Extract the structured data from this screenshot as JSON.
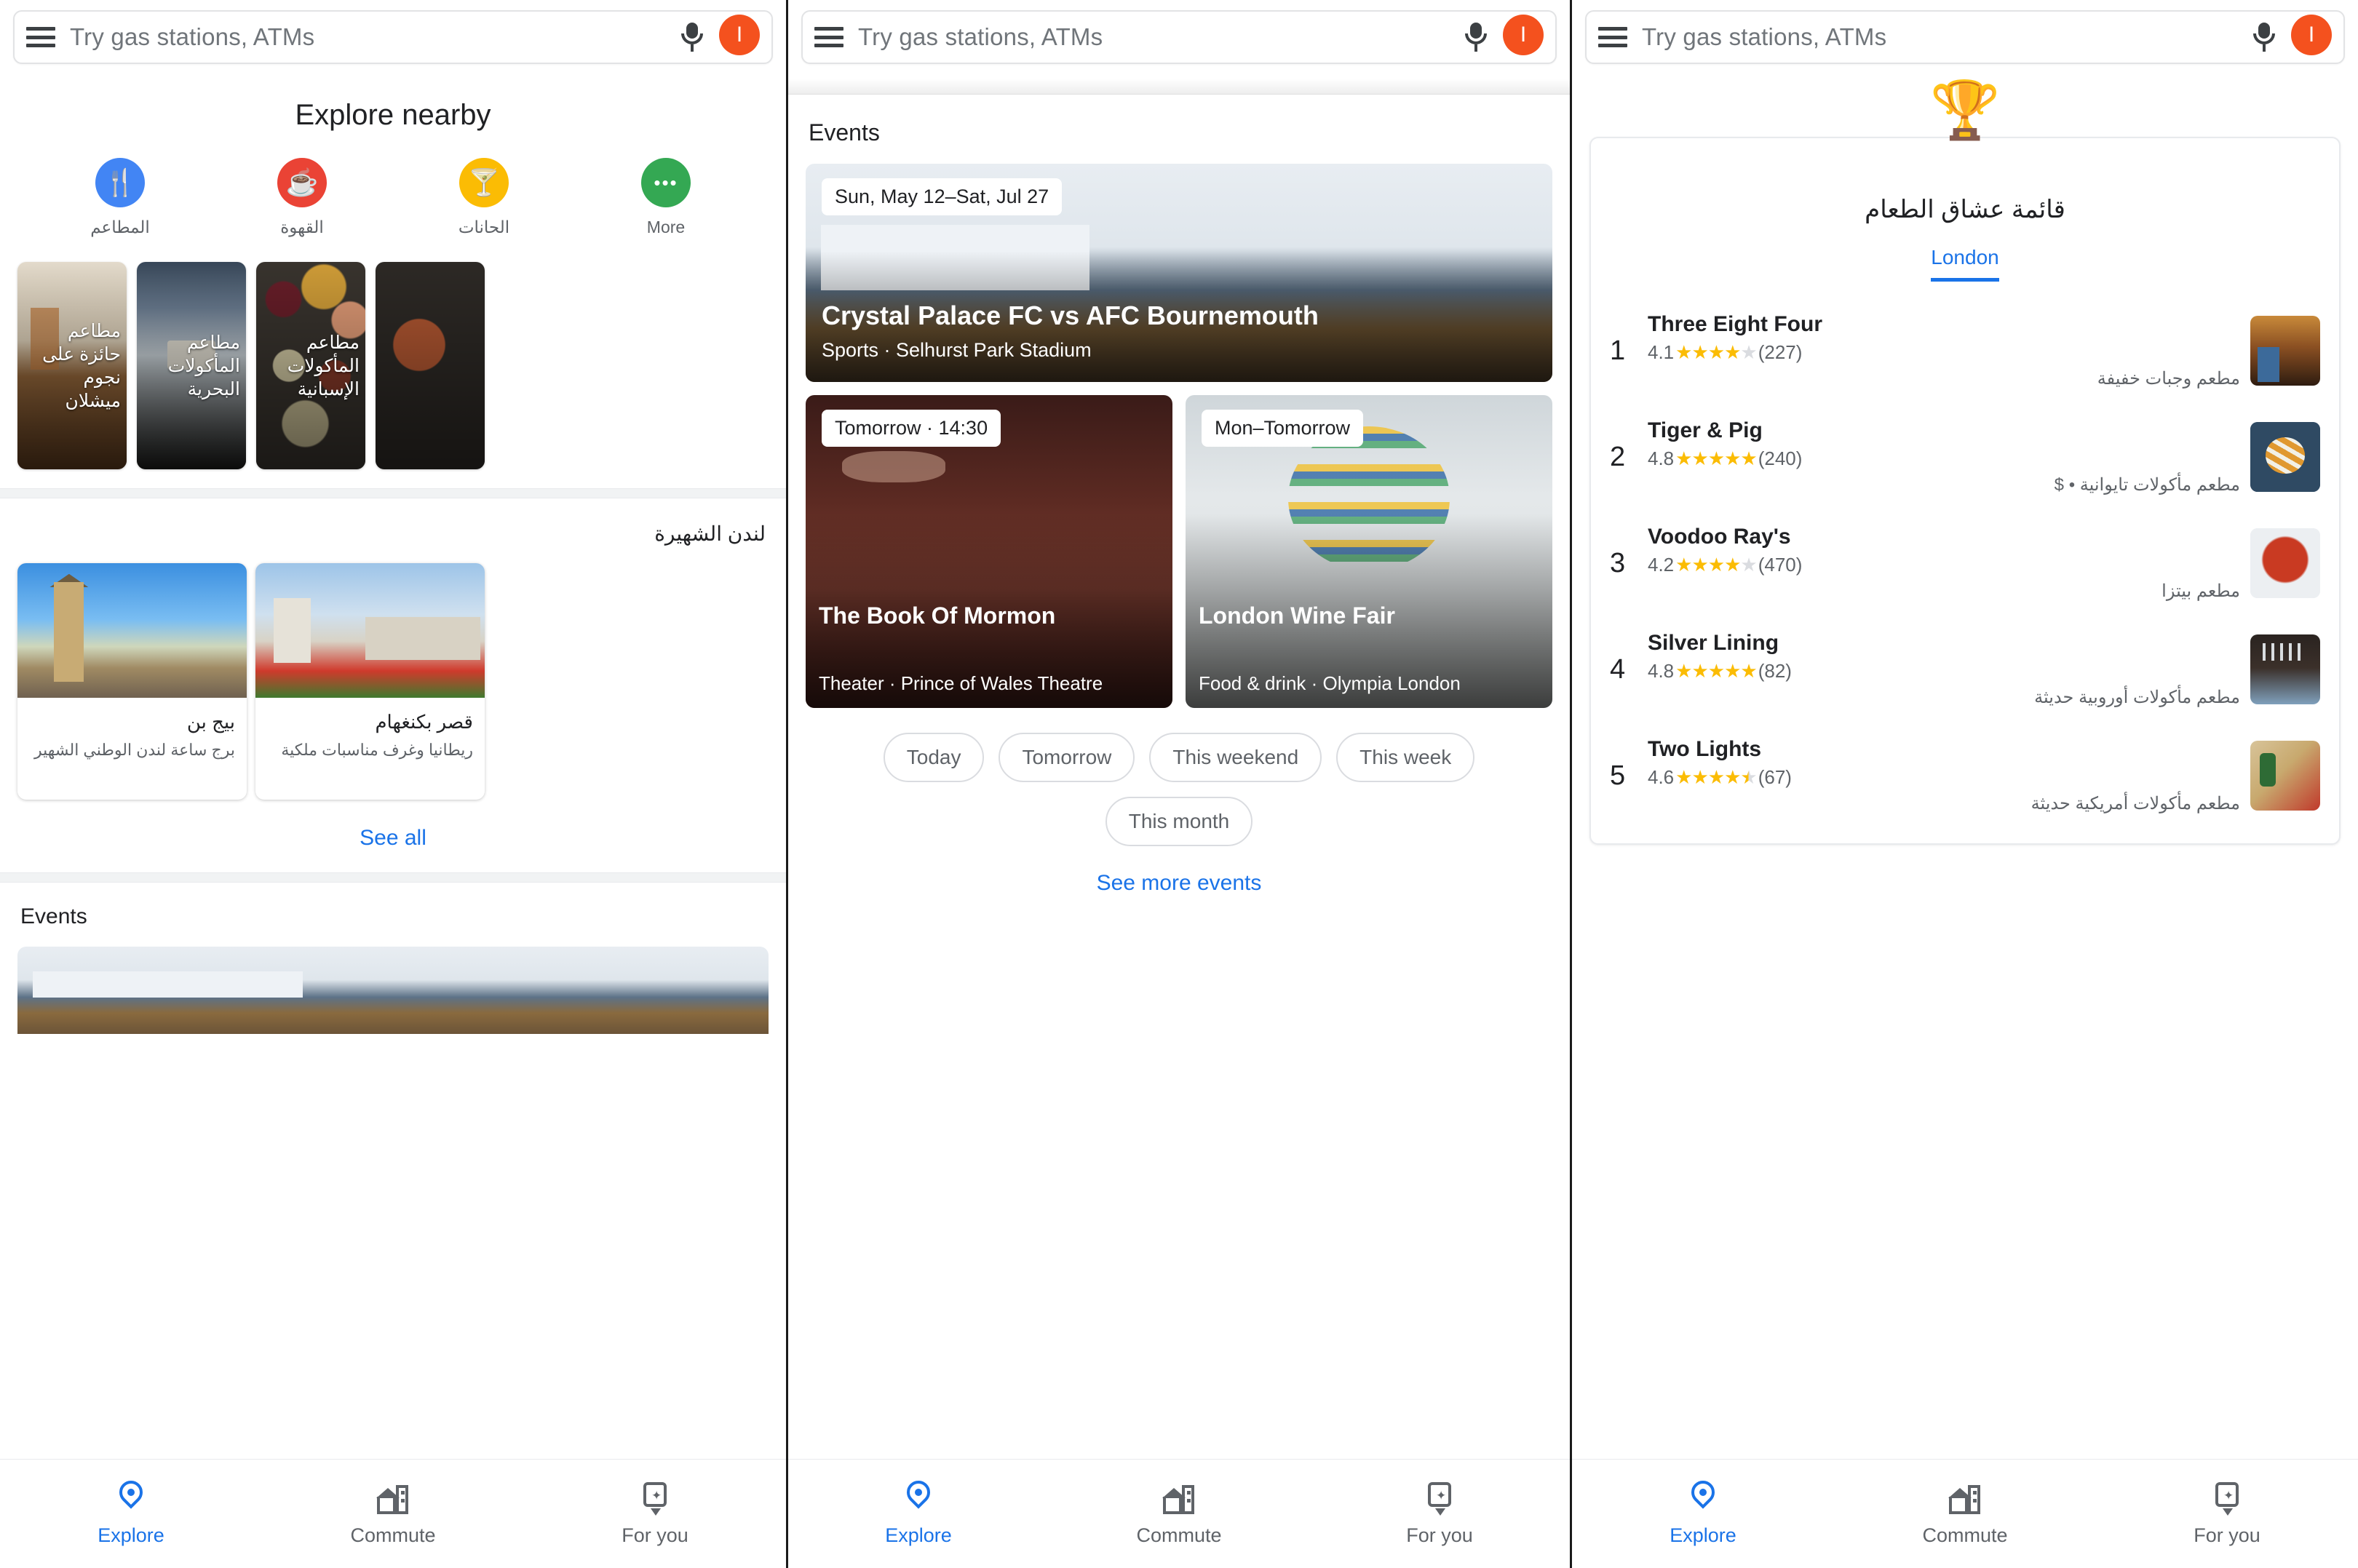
{
  "search": {
    "placeholder": "Try gas stations, ATMs",
    "avatar_letter": "I",
    "avatar_color": "#F4511E",
    "menu_icon": "hamburger-menu-icon",
    "mic_icon": "microphone-icon"
  },
  "panel1": {
    "explore_title": "Explore nearby",
    "categories": [
      {
        "label": "المطاعم",
        "glyph": "🍴",
        "color": "#4285F4",
        "icon": "restaurant-icon"
      },
      {
        "label": "القهوة",
        "glyph": "☕",
        "color": "#EA4335",
        "icon": "coffee-icon"
      },
      {
        "label": "الحانات",
        "glyph": "🍸",
        "color": "#FBBC04",
        "icon": "bar-icon"
      },
      {
        "label": "More",
        "glyph": "•••",
        "color": "#34A853",
        "icon": "more-icon"
      }
    ],
    "food_cards": [
      {
        "caption": "مطاعم حائزة على نجوم ميشلان",
        "ph": "ph-rest1"
      },
      {
        "caption": "مطاعم المأكولات البحرية",
        "ph": "ph-rest2"
      },
      {
        "caption": "مطاعم المأكولات الإسبانية",
        "ph": "ph-food"
      },
      {
        "caption": "",
        "ph": "ph-food2"
      }
    ],
    "landmarks_title": "لندن الشهيرة",
    "landmarks": [
      {
        "name": "بيج بن",
        "desc": "برج ساعة لندن الوطني الشهير",
        "ph": "ph-bigben"
      },
      {
        "name": "قصر بكنغهام",
        "desc": "ريطانيا وغرف مناسبات ملكية",
        "ph": "ph-buck"
      }
    ],
    "see_all": "See all",
    "events_title": "Events"
  },
  "panel2": {
    "events_title": "Events",
    "featured": {
      "date_chip": "Sun, May 12–Sat, Jul 27",
      "title": "Crystal Palace FC vs AFC Bournemouth",
      "subtitle": "Sports · Selhurst Park Stadium",
      "ph": "ph-lounge"
    },
    "small_events": [
      {
        "date_chip": "Tomorrow · 14:30",
        "title": "The Book Of Mormon",
        "subtitle": "Theater · Prince of Wales Theatre",
        "ph": "ph-theater"
      },
      {
        "date_chip": "Mon–Tomorrow",
        "title": "London Wine Fair",
        "subtitle": "Food & drink · Olympia London",
        "ph": "ph-olympia"
      }
    ],
    "filter_chips": [
      "Today",
      "Tomorrow",
      "This weekend",
      "This week",
      "This month"
    ],
    "see_more": "See more events"
  },
  "panel3": {
    "trophy_icon": "trophy-icon",
    "list_title": "قائمة عشاق الطعام",
    "tab_label": "London",
    "restaurants": [
      {
        "rank": "1",
        "name": "Three Eight Four",
        "rating": "4.1",
        "stars_full": 4,
        "stars_half": 0,
        "reviews": "(227)",
        "desc": "مطعم وجبات خفيفة",
        "ph": "ph-t1"
      },
      {
        "rank": "2",
        "name": "Tiger & Pig",
        "rating": "4.8",
        "stars_full": 5,
        "stars_half": 0,
        "reviews": "(240)",
        "desc": "مطعم مأكولات تايوانية • $",
        "ph": "ph-t2"
      },
      {
        "rank": "3",
        "name": "Voodoo Ray's",
        "rating": "4.2",
        "stars_full": 4,
        "stars_half": 0,
        "reviews": "(470)",
        "desc": "مطعم بيتزا",
        "ph": "ph-t3"
      },
      {
        "rank": "4",
        "name": "Silver Lining",
        "rating": "4.8",
        "stars_full": 5,
        "stars_half": 0,
        "reviews": "(82)",
        "desc": "مطعم مأكولات أوروبية حديثة",
        "ph": "ph-t4"
      },
      {
        "rank": "5",
        "name": "Two Lights",
        "rating": "4.6",
        "stars_full": 4,
        "stars_half": 1,
        "reviews": "(67)",
        "desc": "مطعم مأكولات أمريكية حديثة",
        "ph": "ph-t5"
      }
    ]
  },
  "bottom_nav": [
    {
      "label": "Explore",
      "icon": "map-pin-icon",
      "active": true
    },
    {
      "label": "Commute",
      "icon": "commute-building-icon",
      "active": false
    },
    {
      "label": "For you",
      "icon": "for-you-sparkle-icon",
      "active": false
    }
  ],
  "colors": {
    "accent": "#1a73e8",
    "star": "#FBBC04",
    "avatar": "#F4511E"
  }
}
